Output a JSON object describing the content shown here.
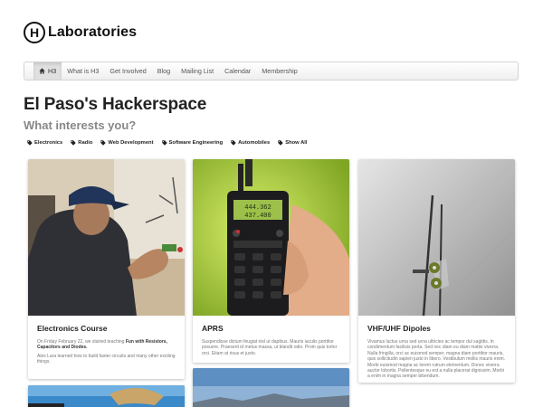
{
  "logo": {
    "mark": "H",
    "text": "Laboratories"
  },
  "nav": {
    "items": [
      {
        "label": "H3",
        "active": true,
        "icon": "home-icon"
      },
      {
        "label": "What is H3"
      },
      {
        "label": "Get Involved"
      },
      {
        "label": "Blog"
      },
      {
        "label": "Mailing List"
      },
      {
        "label": "Calendar"
      },
      {
        "label": "Membership"
      }
    ]
  },
  "page": {
    "title": "El Paso's Hackerspace",
    "subtitle": "What interests you?"
  },
  "tags": [
    "Electronics",
    "Radio",
    "Web Development",
    "Software Engineering",
    "Automobiles",
    "Show All"
  ],
  "cards": [
    {
      "title": "Electronics Course",
      "body_intro": "On Friday February 22, we started teaching ",
      "body_bold": "Fun with Resistors, Capacitors and Diodes.",
      "body_second": "Alex Lara learned how to build faster circuits and many other exciting things."
    },
    {
      "title": "APRS",
      "body": "Suspendisse dictum feugiat nisl ut dapibus. Mauris iaculis porttitor posuere. Praesent id metus massa, ut blandit odio. Proin quis tortor orci. Etiam at risus et justo."
    },
    {
      "title": "VHF/UHF Dipoles",
      "body": "Vivamus luctus urna sed urna ultricies ac tempor dui sagittis. In condimentum facilisis porta. Sed nec diam eu diam mattis viverra. Nulla fringilla, orci ac euismod semper, magna diam porttitor mauris, quis sollicitudin sapien justo in libero. Vestibulum mollis mauris enim. Morbi euismod magna ac lorem rutrum elementum. Donec viverra auctor lobortis. Pellentesque eu est a nulla placerat dignissim. Morbi a enim in magna semper bibendum."
    }
  ],
  "radio_display": {
    "line1": "444.362",
    "line2": "437.400"
  },
  "colors": {
    "nav_bg": "#efefef",
    "subtitle": "#888888",
    "title": "#222222"
  }
}
